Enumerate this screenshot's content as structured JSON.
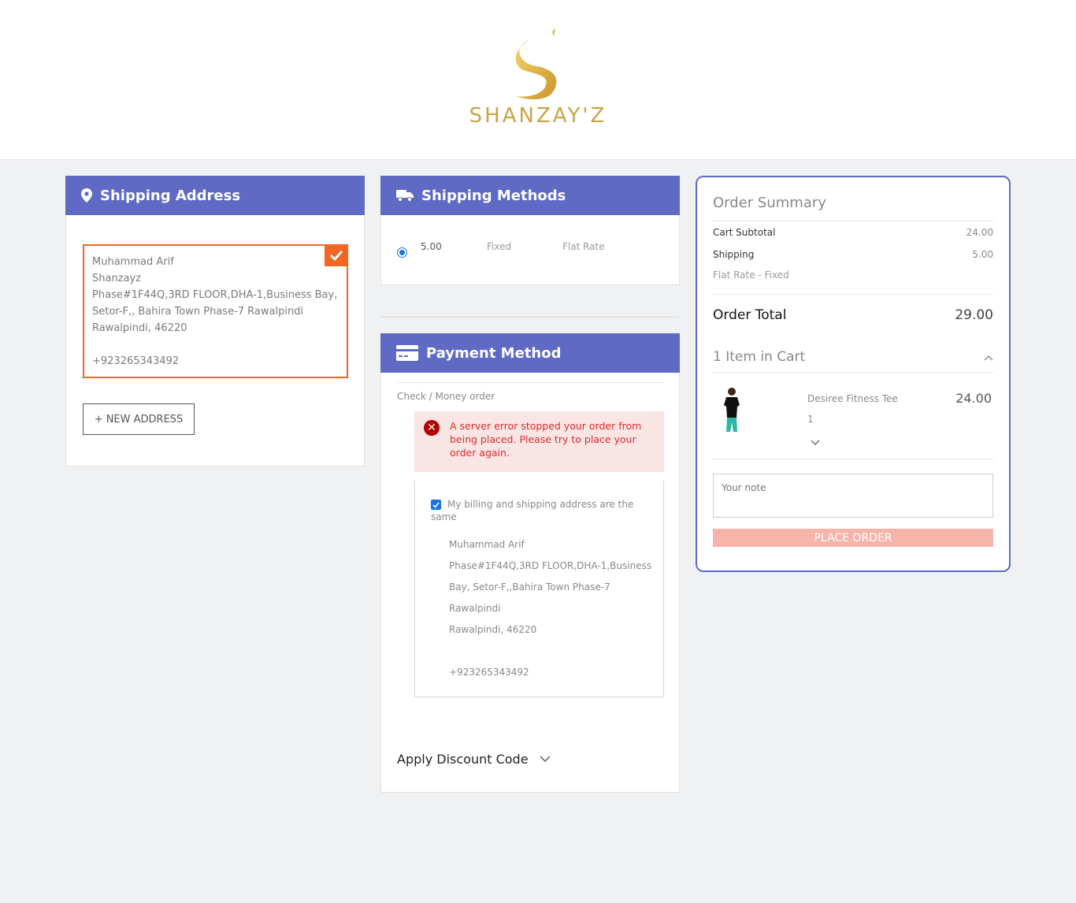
{
  "brand": {
    "name": "SHANZAY'Z",
    "logo_icon": "s-logo-icon",
    "color": "#c9a445"
  },
  "shipping_address": {
    "title": "Shipping Address",
    "icon": "map-pin-icon",
    "card": {
      "name": "Muhammad Arif",
      "company": "Shanzayz",
      "street": "Phase#1F44Q,3RD FLOOR,DHA-1,Business Bay, Setor-F,, Bahira Town Phase-7 Rawalpindi",
      "city_zip": "Rawalpindi, 46220",
      "phone": "+923265343492"
    },
    "new_address_label": "+ NEW ADDRESS"
  },
  "shipping_methods": {
    "title": "Shipping Methods",
    "icon": "truck-icon",
    "methods": [
      {
        "price": "5.00",
        "type": "Fixed",
        "carrier": "Flat Rate",
        "selected": true
      }
    ]
  },
  "payment": {
    "title": "Payment Method",
    "icon": "credit-card-icon",
    "method_label": "Check / Money order",
    "error": "A server error stopped your order from being placed. Please try to place your order again.",
    "billing_same_label": "My billing and shipping address are the same",
    "billing_same": true,
    "billing": {
      "name": "Muhammad Arif",
      "line1": "Phase#1F44Q,3RD FLOOR,DHA-1,Business",
      "line2": "Bay, Setor-F,,Bahira Town Phase-7",
      "line3": "Rawalpindi",
      "city_zip": "Rawalpindi, 46220",
      "phone": "+923265343492"
    },
    "discount_label": "Apply Discount Code"
  },
  "summary": {
    "title": "Order Summary",
    "subtotal_label": "Cart Subtotal",
    "subtotal": "24.00",
    "shipping_label": "Shipping",
    "shipping": "5.00",
    "shipping_method": "Flat Rate - Fixed",
    "total_label": "Order Total",
    "total": "29.00",
    "cart_label": "1 Item in Cart",
    "items": [
      {
        "name": "Desiree Fitness Tee",
        "qty": "1",
        "price": "24.00"
      }
    ],
    "note_placeholder": "Your note",
    "place_order_label": "PLACE ORDER"
  },
  "colors": {
    "accent": "#5f6ac4",
    "selected": "#f26522",
    "error_bg": "#fae5e5",
    "error_text": "#e02b27",
    "place_order": "#f7b4aa"
  }
}
